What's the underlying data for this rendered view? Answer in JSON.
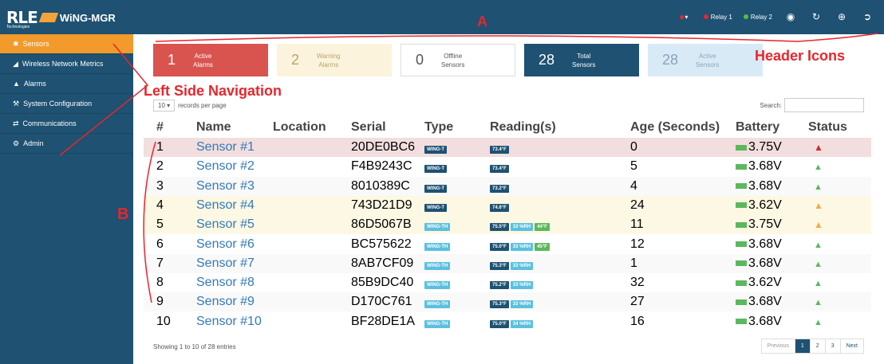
{
  "app": {
    "brand": "RLE",
    "brand_sub": "Technologies",
    "product": "WiNG-MGR"
  },
  "header": {
    "relay1": "Relay 1",
    "relay2": "Relay 2",
    "icons": [
      "user-dropdown-icon",
      "map-pin-icon",
      "refresh-icon",
      "globe-icon",
      "logout-icon"
    ]
  },
  "sidebar": {
    "items": [
      {
        "label": "Sensors",
        "icon": "sensor-icon"
      },
      {
        "label": "Wireless Network Metrics",
        "icon": "signal-icon"
      },
      {
        "label": "Alarms",
        "icon": "bell-icon"
      },
      {
        "label": "System Configuration",
        "icon": "tools-icon"
      },
      {
        "label": "Communications",
        "icon": "arrows-icon"
      },
      {
        "label": "Admin",
        "icon": "gears-icon"
      }
    ]
  },
  "cards": [
    {
      "num": "1",
      "label": "Active\nAlarms"
    },
    {
      "num": "2",
      "label": "Warning\nAlarms"
    },
    {
      "num": "0",
      "label": "Offline\nSensors"
    },
    {
      "num": "28",
      "label": "Total\nSensors"
    },
    {
      "num": "28",
      "label": "Active\nSensors"
    }
  ],
  "controls": {
    "page_size": "10",
    "records_label": "records per page",
    "search_label": "Search:",
    "showing": "Showing 1 to 10 of 28 entries"
  },
  "columns": [
    "#",
    "Name",
    "Location",
    "Serial",
    "Type",
    "Reading(s)",
    "Age (Seconds)",
    "Battery",
    "Status"
  ],
  "rows": [
    {
      "n": "1",
      "name": "Sensor #1",
      "serial": "20DE0BC6",
      "type": "WING-T",
      "readings": [
        "73.4°F"
      ],
      "age": "0",
      "battery": "3.75V",
      "status": "alarm"
    },
    {
      "n": "2",
      "name": "Sensor #2",
      "serial": "F4B9243C",
      "type": "WING-T",
      "readings": [
        "73.4°F"
      ],
      "age": "5",
      "battery": "3.68V",
      "status": "ok"
    },
    {
      "n": "3",
      "name": "Sensor #3",
      "serial": "8010389C",
      "type": "WING-T",
      "readings": [
        "73.2°F"
      ],
      "age": "4",
      "battery": "3.68V",
      "status": "ok"
    },
    {
      "n": "4",
      "name": "Sensor #4",
      "serial": "743D21D9",
      "type": "WING-T",
      "readings": [
        "74.6°F"
      ],
      "age": "24",
      "battery": "3.62V",
      "status": "warn"
    },
    {
      "n": "5",
      "name": "Sensor #5",
      "serial": "86D5067B",
      "type": "WING-TH",
      "readings": [
        "75.5°F",
        "33 %RH",
        "44°F"
      ],
      "age": "11",
      "battery": "3.75V",
      "status": "warn"
    },
    {
      "n": "6",
      "name": "Sensor #6",
      "serial": "BC575622",
      "type": "WING-TH",
      "readings": [
        "75.0°F",
        "33 %RH",
        "45°F"
      ],
      "age": "12",
      "battery": "3.68V",
      "status": "ok"
    },
    {
      "n": "7",
      "name": "Sensor #7",
      "serial": "8AB7CF09",
      "type": "WING-TH",
      "readings": [
        "75.3°F",
        "33 %RH"
      ],
      "age": "1",
      "battery": "3.68V",
      "status": "ok"
    },
    {
      "n": "8",
      "name": "Sensor #8",
      "serial": "85B9DC40",
      "type": "WING-TH",
      "readings": [
        "75.2°F",
        "33 %RH"
      ],
      "age": "32",
      "battery": "3.62V",
      "status": "ok"
    },
    {
      "n": "9",
      "name": "Sensor #9",
      "serial": "D170C761",
      "type": "WING-TH",
      "readings": [
        "75.3°F",
        "33 %RH"
      ],
      "age": "27",
      "battery": "3.68V",
      "status": "ok"
    },
    {
      "n": "10",
      "name": "Sensor #10",
      "serial": "BF28DE1A",
      "type": "WING-TH",
      "readings": [
        "75.0°F",
        "34 %RH"
      ],
      "age": "16",
      "battery": "3.68V",
      "status": "ok"
    }
  ],
  "pager": [
    "Previous",
    "1",
    "2",
    "3",
    "Next"
  ],
  "annotations": {
    "a": "A",
    "header_icons": "Header Icons",
    "left_nav": "Left Side Navigation",
    "b": "B"
  }
}
